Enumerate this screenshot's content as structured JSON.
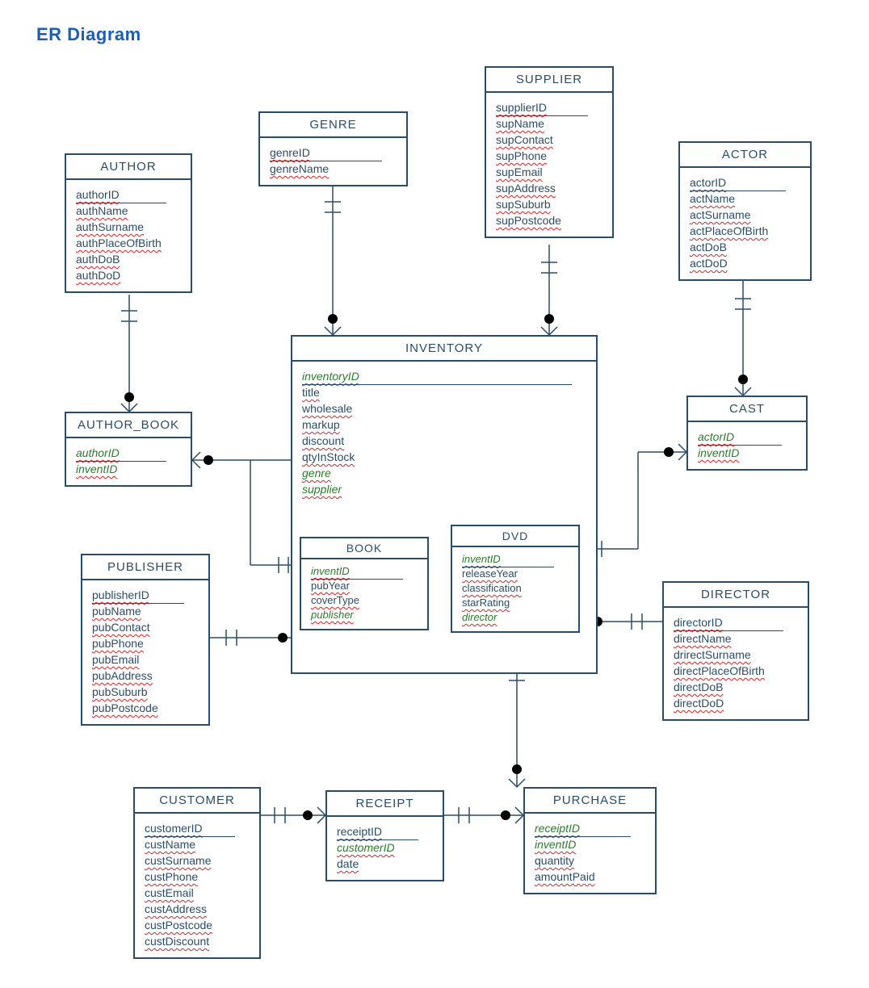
{
  "title": "ER Diagram",
  "entities": {
    "author": {
      "name": "AUTHOR",
      "attrs": [
        "authorID",
        "authName",
        "authSurname",
        "authPlaceOfBirth",
        "authDoB",
        "authDoD"
      ]
    },
    "genre": {
      "name": "GENRE",
      "attrs": [
        "genreID",
        "genreName"
      ]
    },
    "supplier": {
      "name": "SUPPLIER",
      "attrs": [
        "supplierID",
        "supName",
        "supContact",
        "supPhone",
        "supEmail",
        "supAddress",
        "supSuburb",
        "supPostcode"
      ]
    },
    "actor": {
      "name": "ACTOR",
      "attrs": [
        "actorID",
        "actName",
        "actSurname",
        "actPlaceOfBirth",
        "actDoB",
        "actDoD"
      ]
    },
    "author_book": {
      "name": "AUTHOR_BOOK",
      "attrs": [
        "authorID",
        "inventID"
      ]
    },
    "inventory": {
      "name": "INVENTORY",
      "attrs": [
        "inventoryID",
        "title",
        "wholesale",
        "markup",
        "discount",
        "qtyInStock",
        "genre",
        "supplier"
      ]
    },
    "cast": {
      "name": "CAST",
      "attrs": [
        "actorID",
        "inventID"
      ]
    },
    "publisher": {
      "name": "PUBLISHER",
      "attrs": [
        "publisherID",
        "pubName",
        "pubContact",
        "pubPhone",
        "pubEmail",
        "pubAddress",
        "pubSuburb",
        "pubPostcode"
      ]
    },
    "book": {
      "name": "BOOK",
      "attrs": [
        "inventID",
        "pubYear",
        "coverType",
        "publisher"
      ]
    },
    "dvd": {
      "name": "DVD",
      "attrs": [
        "inventID",
        "releaseYear",
        "classification",
        "starRating",
        "director"
      ]
    },
    "director": {
      "name": "DIRECTOR",
      "attrs": [
        "directorID",
        "directName",
        "drirectSurname",
        "directPlaceOfBirth",
        "directDoB",
        "directDoD"
      ]
    },
    "customer": {
      "name": "CUSTOMER",
      "attrs": [
        "customerID",
        "custName",
        "custSurname",
        "custPhone",
        "custEmail",
        "custAddress",
        "custPostcode",
        "custDiscount"
      ]
    },
    "receipt": {
      "name": "RECEIPT",
      "attrs": [
        "receiptID",
        "customerID",
        "date"
      ]
    },
    "purchase": {
      "name": "PURCHASE",
      "attrs": [
        "receiptID",
        "inventID",
        "quantity",
        "amountPaid"
      ]
    }
  },
  "chart_data": {
    "type": "er-diagram",
    "entities": [
      {
        "name": "AUTHOR",
        "pk": [
          "authorID"
        ],
        "attrs": [
          "authorID",
          "authName",
          "authSurname",
          "authPlaceOfBirth",
          "authDoB",
          "authDoD"
        ]
      },
      {
        "name": "GENRE",
        "pk": [
          "genreID"
        ],
        "attrs": [
          "genreID",
          "genreName"
        ]
      },
      {
        "name": "SUPPLIER",
        "pk": [
          "supplierID"
        ],
        "attrs": [
          "supplierID",
          "supName",
          "supContact",
          "supPhone",
          "supEmail",
          "supAddress",
          "supSuburb",
          "supPostcode"
        ]
      },
      {
        "name": "ACTOR",
        "pk": [
          "actorID"
        ],
        "attrs": [
          "actorID",
          "actName",
          "actSurname",
          "actPlaceOfBirth",
          "actDoB",
          "actDoD"
        ]
      },
      {
        "name": "AUTHOR_BOOK",
        "pk": [
          "authorID",
          "inventID"
        ],
        "fk": [
          "authorID",
          "inventID"
        ],
        "attrs": [
          "authorID",
          "inventID"
        ]
      },
      {
        "name": "INVENTORY",
        "pk": [
          "inventoryID"
        ],
        "fk": [
          "genre",
          "supplier"
        ],
        "attrs": [
          "inventoryID",
          "title",
          "wholesale",
          "markup",
          "discount",
          "qtyInStock",
          "genre",
          "supplier"
        ]
      },
      {
        "name": "CAST",
        "pk": [
          "actorID",
          "inventID"
        ],
        "fk": [
          "actorID",
          "inventID"
        ],
        "attrs": [
          "actorID",
          "inventID"
        ]
      },
      {
        "name": "PUBLISHER",
        "pk": [
          "publisherID"
        ],
        "attrs": [
          "publisherID",
          "pubName",
          "pubContact",
          "pubPhone",
          "pubEmail",
          "pubAddress",
          "pubSuburb",
          "pubPostcode"
        ]
      },
      {
        "name": "BOOK",
        "pk": [
          "inventID"
        ],
        "fk": [
          "inventID",
          "publisher"
        ],
        "attrs": [
          "inventID",
          "pubYear",
          "coverType",
          "publisher"
        ]
      },
      {
        "name": "DVD",
        "pk": [
          "inventID"
        ],
        "fk": [
          "inventID",
          "director"
        ],
        "attrs": [
          "inventID",
          "releaseYear",
          "classification",
          "starRating",
          "director"
        ]
      },
      {
        "name": "DIRECTOR",
        "pk": [
          "directorID"
        ],
        "attrs": [
          "directorID",
          "directName",
          "drirectSurname",
          "directPlaceOfBirth",
          "directDoB",
          "directDoD"
        ]
      },
      {
        "name": "CUSTOMER",
        "pk": [
          "customerID"
        ],
        "attrs": [
          "customerID",
          "custName",
          "custSurname",
          "custPhone",
          "custEmail",
          "custAddress",
          "custPostcode",
          "custDiscount"
        ]
      },
      {
        "name": "RECEIPT",
        "pk": [
          "receiptID"
        ],
        "fk": [
          "customerID"
        ],
        "attrs": [
          "receiptID",
          "customerID",
          "date"
        ]
      },
      {
        "name": "PURCHASE",
        "pk": [
          "receiptID",
          "inventID"
        ],
        "fk": [
          "receiptID",
          "inventID"
        ],
        "attrs": [
          "receiptID",
          "inventID",
          "quantity",
          "amountPaid"
        ]
      }
    ],
    "relationships": [
      {
        "from": "AUTHOR",
        "to": "AUTHOR_BOOK",
        "card_from": "1",
        "card_to": "many"
      },
      {
        "from": "AUTHOR_BOOK",
        "to": "BOOK",
        "card_from": "many",
        "card_to": "1"
      },
      {
        "from": "GENRE",
        "to": "INVENTORY",
        "card_from": "1",
        "card_to": "many"
      },
      {
        "from": "SUPPLIER",
        "to": "INVENTORY",
        "card_from": "1",
        "card_to": "many"
      },
      {
        "from": "ACTOR",
        "to": "CAST",
        "card_from": "1",
        "card_to": "many"
      },
      {
        "from": "CAST",
        "to": "DVD",
        "card_from": "many",
        "card_to": "1"
      },
      {
        "from": "PUBLISHER",
        "to": "BOOK",
        "card_from": "1",
        "card_to": "many"
      },
      {
        "from": "DVD",
        "to": "DIRECTOR",
        "card_from": "many",
        "card_to": "1"
      },
      {
        "from": "INVENTORY",
        "to": "PURCHASE",
        "card_from": "1",
        "card_to": "many"
      },
      {
        "from": "CUSTOMER",
        "to": "RECEIPT",
        "card_from": "1",
        "card_to": "many"
      },
      {
        "from": "RECEIPT",
        "to": "PURCHASE",
        "card_from": "1",
        "card_to": "many"
      }
    ]
  }
}
